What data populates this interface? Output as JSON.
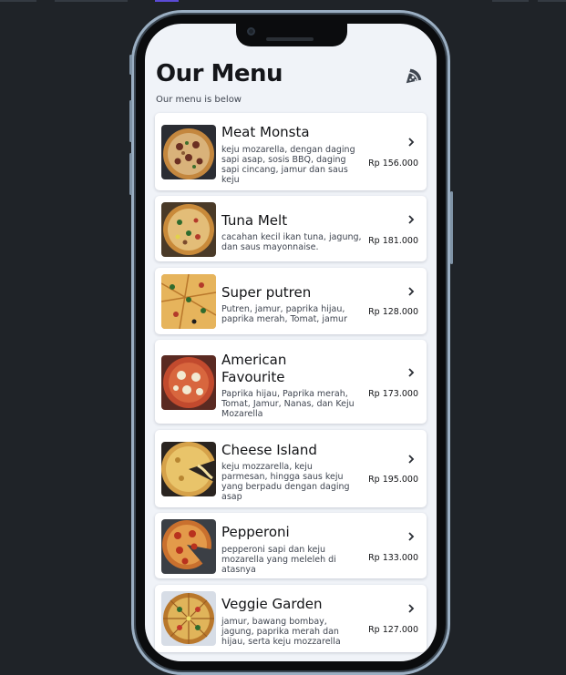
{
  "header": {
    "title": "Our Menu",
    "subtitle": "Our menu is below",
    "icon": "pizza-slice-icon"
  },
  "menu": [
    {
      "name": "Meat Monsta",
      "desc": "keju mozarella, dengan daging sapi asap, sosis BBQ, daging sapi cincang, jamur dan saus keju",
      "price": "Rp 156.000"
    },
    {
      "name": "Tuna Melt",
      "desc": "cacahan kecil ikan tuna, jagung, dan saus mayonnaise.",
      "price": "Rp 181.000"
    },
    {
      "name": "Super putren",
      "desc": "Putren, jamur, paprika hijau, paprika merah, Tomat, jamur",
      "price": "Rp 128.000"
    },
    {
      "name": "American Favourite",
      "desc": "Paprika hijau, Paprika merah, Tomat, Jamur, Nanas, dan Keju  Mozarella",
      "price": "Rp 173.000"
    },
    {
      "name": "Cheese Island",
      "desc": "keju mozzarella, keju parmesan, hingga saus keju yang berpadu dengan daging asap",
      "price": "Rp 195.000"
    },
    {
      "name": "Pepperoni",
      "desc": "pepperoni sapi dan keju mozarella yang meleleh di atasnya",
      "price": "Rp 133.000"
    },
    {
      "name": "Veggie Garden",
      "desc": "jamur, bawang bombay, jagung, paprika merah dan hijau, serta keju mozzarella",
      "price": "Rp 127.000"
    }
  ],
  "colors": {
    "background": "#1f2328",
    "screen": "#f0f3f8",
    "card": "#ffffff",
    "text": "#121316",
    "muted": "#3f4550",
    "icon": "#3f4650"
  }
}
